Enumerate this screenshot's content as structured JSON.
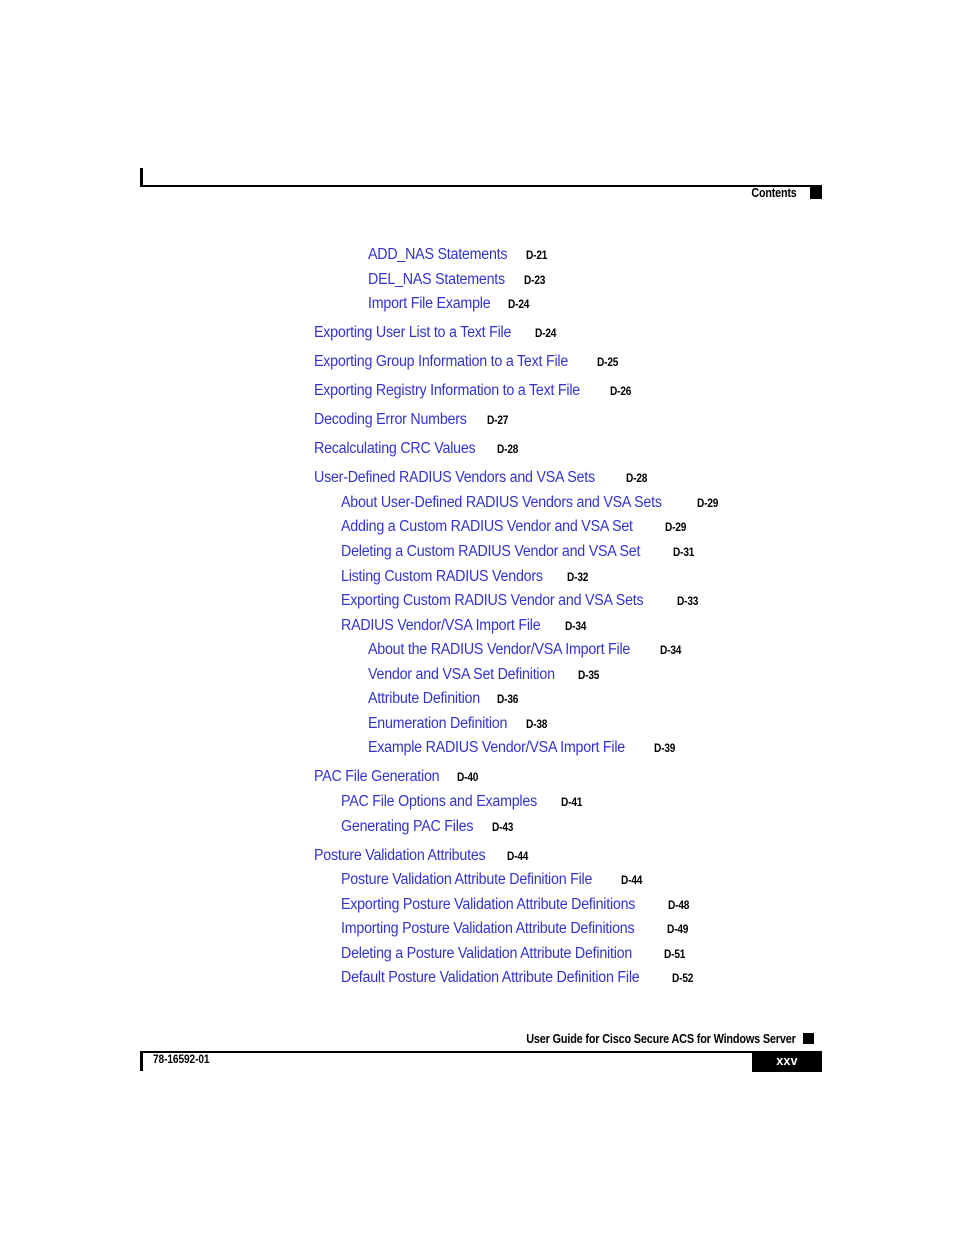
{
  "header": {
    "label": "Contents",
    "marker_icon": "black-square-marker"
  },
  "toc": {
    "entries": [
      {
        "title": "ADD_NAS Statements",
        "page": "D-21",
        "level": 3
      },
      {
        "title": "DEL_NAS Statements",
        "page": "D-23",
        "level": 3
      },
      {
        "title": "Import File Example",
        "page": "D-24",
        "level": 3
      },
      {
        "title": "Exporting User List to a Text File",
        "page": "D-24",
        "level": 1
      },
      {
        "title": "Exporting Group Information to a Text File",
        "page": "D-25",
        "level": 1
      },
      {
        "title": "Exporting Registry Information to a Text File",
        "page": "D-26",
        "level": 1
      },
      {
        "title": "Decoding Error Numbers",
        "page": "D-27",
        "level": 1
      },
      {
        "title": "Recalculating CRC Values",
        "page": "D-28",
        "level": 1
      },
      {
        "title": "User-Defined RADIUS Vendors and VSA Sets",
        "page": "D-28",
        "level": 1
      },
      {
        "title": "About User-Defined RADIUS Vendors and VSA Sets",
        "page": "D-29",
        "level": 2
      },
      {
        "title": "Adding a Custom RADIUS Vendor and VSA Set",
        "page": "D-29",
        "level": 2
      },
      {
        "title": "Deleting a Custom RADIUS Vendor and VSA Set",
        "page": "D-31",
        "level": 2
      },
      {
        "title": "Listing Custom RADIUS Vendors",
        "page": "D-32",
        "level": 2
      },
      {
        "title": "Exporting Custom RADIUS Vendor and VSA Sets",
        "page": "D-33",
        "level": 2
      },
      {
        "title": "RADIUS Vendor/VSA Import File",
        "page": "D-34",
        "level": 2
      },
      {
        "title": "About the RADIUS Vendor/VSA Import File",
        "page": "D-34",
        "level": 3
      },
      {
        "title": "Vendor and VSA Set Definition",
        "page": "D-35",
        "level": 3
      },
      {
        "title": "Attribute Definition",
        "page": "D-36",
        "level": 3
      },
      {
        "title": "Enumeration Definition",
        "page": "D-38",
        "level": 3
      },
      {
        "title": "Example RADIUS Vendor/VSA Import File",
        "page": "D-39",
        "level": 3
      },
      {
        "title": "PAC File Generation",
        "page": "D-40",
        "level": 1
      },
      {
        "title": "PAC File Options and Examples",
        "page": "D-41",
        "level": 2
      },
      {
        "title": "Generating PAC Files",
        "page": "D-43",
        "level": 2
      },
      {
        "title": "Posture Validation Attributes",
        "page": "D-44",
        "level": 1
      },
      {
        "title": "Posture Validation Attribute Definition File",
        "page": "D-44",
        "level": 2
      },
      {
        "title": "Exporting Posture Validation Attribute Definitions",
        "page": "D-48",
        "level": 2
      },
      {
        "title": "Importing Posture Validation Attribute Definitions",
        "page": "D-49",
        "level": 2
      },
      {
        "title": "Deleting a Posture Validation Attribute Definition",
        "page": "D-51",
        "level": 2
      },
      {
        "title": "Default Posture Validation Attribute Definition File",
        "page": "D-52",
        "level": 2
      }
    ]
  },
  "footer": {
    "title": "User Guide for Cisco Secure ACS for Windows Server",
    "doc_number": "78-16592-01",
    "page_number": "xxv",
    "marker_icon": "black-square-marker"
  },
  "colors": {
    "link_blue": "#3333cc",
    "rule_black": "#000000",
    "page_box_background": "#000000",
    "page_box_text": "#ffffff"
  }
}
